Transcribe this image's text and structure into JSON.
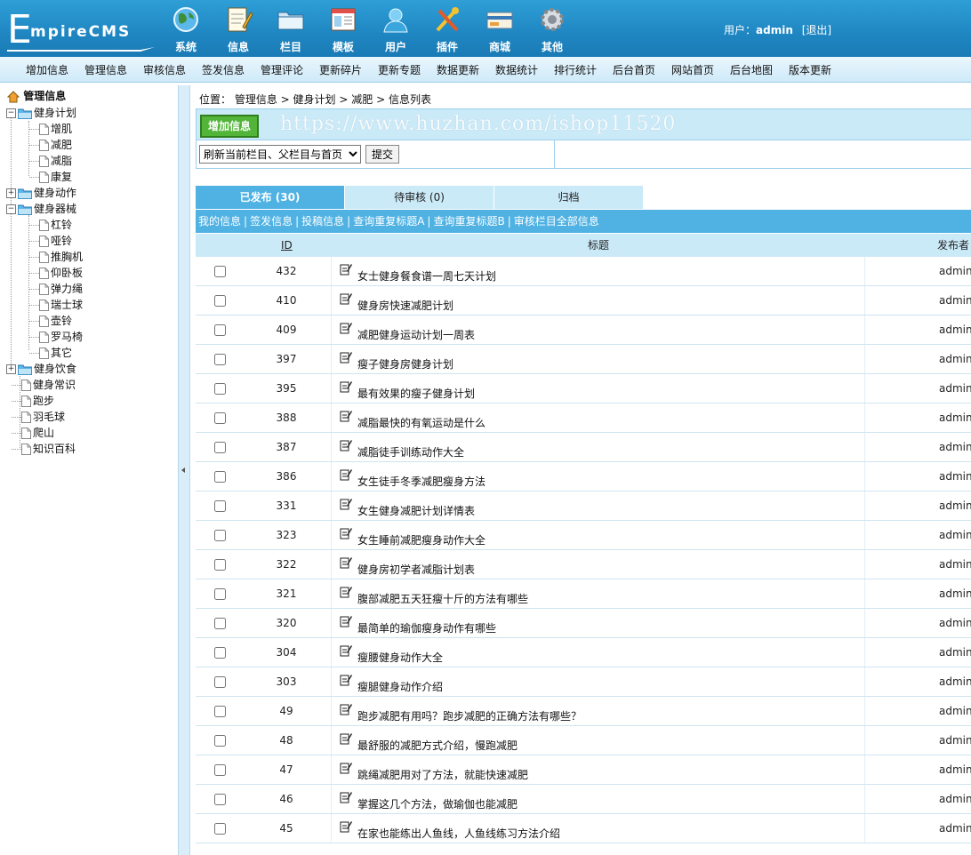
{
  "logo": {
    "first_letter": "E",
    "rest": "mpireCMS"
  },
  "top_menu": [
    {
      "label": "系统",
      "icon": "globe-icon"
    },
    {
      "label": "信息",
      "icon": "notepad-icon"
    },
    {
      "label": "栏目",
      "icon": "folder-icon"
    },
    {
      "label": "模板",
      "icon": "window-template-icon"
    },
    {
      "label": "用户",
      "icon": "user-icon"
    },
    {
      "label": "插件",
      "icon": "tools-icon"
    },
    {
      "label": "商城",
      "icon": "card-icon"
    },
    {
      "label": "其他",
      "icon": "gear-icon"
    }
  ],
  "user": {
    "prefix": "用户：",
    "name": "admin",
    "logout": "[退出]"
  },
  "sub_nav": [
    "增加信息",
    "管理信息",
    "审核信息",
    "签发信息",
    "管理评论",
    "更新碎片",
    "更新专题",
    "数据更新",
    "数据统计",
    "排行统计",
    "后台首页",
    "网站首页",
    "后台地图",
    "版本更新"
  ],
  "tree": {
    "root": "管理信息",
    "items": [
      {
        "label": "健身计划",
        "type": "folder",
        "level": 0,
        "toggle": "−"
      },
      {
        "label": "增肌",
        "type": "page",
        "level": 1
      },
      {
        "label": "减肥",
        "type": "page",
        "level": 1
      },
      {
        "label": "减脂",
        "type": "page",
        "level": 1
      },
      {
        "label": "康复",
        "type": "page",
        "level": 1
      },
      {
        "label": "健身动作",
        "type": "folder",
        "level": 0,
        "toggle": "+"
      },
      {
        "label": "健身器械",
        "type": "folder",
        "level": 0,
        "toggle": "−"
      },
      {
        "label": "杠铃",
        "type": "page",
        "level": 1
      },
      {
        "label": "哑铃",
        "type": "page",
        "level": 1
      },
      {
        "label": "推胸机",
        "type": "page",
        "level": 1
      },
      {
        "label": "仰卧板",
        "type": "page",
        "level": 1
      },
      {
        "label": "弹力绳",
        "type": "page",
        "level": 1
      },
      {
        "label": "瑞士球",
        "type": "page",
        "level": 1
      },
      {
        "label": "壶铃",
        "type": "page",
        "level": 1
      },
      {
        "label": "罗马椅",
        "type": "page",
        "level": 1
      },
      {
        "label": "其它",
        "type": "page",
        "level": 1
      },
      {
        "label": "健身饮食",
        "type": "folder",
        "level": 0,
        "toggle": "+"
      },
      {
        "label": "健身常识",
        "type": "page",
        "level": 0
      },
      {
        "label": "跑步",
        "type": "page",
        "level": 0
      },
      {
        "label": "羽毛球",
        "type": "page",
        "level": 0
      },
      {
        "label": "爬山",
        "type": "page",
        "level": 0
      },
      {
        "label": "知识百科",
        "type": "page",
        "level": 0
      }
    ]
  },
  "breadcrumb": {
    "prefix": "位置：",
    "path": [
      "管理信息",
      "健身计划",
      "减肥",
      "信息列表"
    ],
    "sep": " > "
  },
  "actions": {
    "add_label": "增加信息",
    "watermark": "https://www.huzhan.com/ishop11520",
    "refresh_option": "刷新当前栏目、父栏目与首页",
    "submit_label": "提交"
  },
  "tabs": [
    {
      "label": "已发布 (30)",
      "active": true
    },
    {
      "label": "待审核 (0)",
      "active": false
    },
    {
      "label": "归档",
      "active": false
    }
  ],
  "filters": [
    "我的信息",
    "签发信息",
    "投稿信息",
    "查询重复标题A",
    "查询重复标题B",
    "审核栏目全部信息"
  ],
  "table": {
    "headers": {
      "id": "ID",
      "title": "标题",
      "author": "发布者"
    },
    "rows": [
      {
        "id": "432",
        "title": "女士健身餐食谱一周七天计划",
        "author": "admin"
      },
      {
        "id": "410",
        "title": "健身房快速减肥计划",
        "author": "admin"
      },
      {
        "id": "409",
        "title": "减肥健身运动计划一周表",
        "author": "admin"
      },
      {
        "id": "397",
        "title": "瘦子健身房健身计划",
        "author": "admin"
      },
      {
        "id": "395",
        "title": "最有效果的瘦子健身计划",
        "author": "admin"
      },
      {
        "id": "388",
        "title": "减脂最快的有氧运动是什么",
        "author": "admin"
      },
      {
        "id": "387",
        "title": "减脂徒手训练动作大全",
        "author": "admin"
      },
      {
        "id": "386",
        "title": "女生徒手冬季减肥瘦身方法",
        "author": "admin"
      },
      {
        "id": "331",
        "title": "女生健身减肥计划详情表",
        "author": "admin"
      },
      {
        "id": "323",
        "title": "女生睡前减肥瘦身动作大全",
        "author": "admin"
      },
      {
        "id": "322",
        "title": "健身房初学者减脂计划表",
        "author": "admin"
      },
      {
        "id": "321",
        "title": "腹部减肥五天狂瘦十斤的方法有哪些",
        "author": "admin"
      },
      {
        "id": "320",
        "title": "最简单的瑜伽瘦身动作有哪些",
        "author": "admin"
      },
      {
        "id": "304",
        "title": "瘦腰健身动作大全",
        "author": "admin"
      },
      {
        "id": "303",
        "title": "瘦腿健身动作介绍",
        "author": "admin"
      },
      {
        "id": "49",
        "title": "跑步减肥有用吗？跑步减肥的正确方法有哪些？",
        "author": "admin"
      },
      {
        "id": "48",
        "title": "最舒服的减肥方式介绍，慢跑减肥",
        "author": "admin"
      },
      {
        "id": "47",
        "title": "跳绳减肥用对了方法，就能快速减肥",
        "author": "admin"
      },
      {
        "id": "46",
        "title": "掌握这几个方法，做瑜伽也能减肥",
        "author": "admin"
      },
      {
        "id": "45",
        "title": "在家也能练出人鱼线，人鱼线练习方法介绍",
        "author": "admin"
      }
    ]
  },
  "colors": {
    "header": "#1f86c2",
    "tab_active": "#4fb2e3",
    "tab_inactive": "#cbeaf8",
    "add_button": "#52b53a"
  }
}
